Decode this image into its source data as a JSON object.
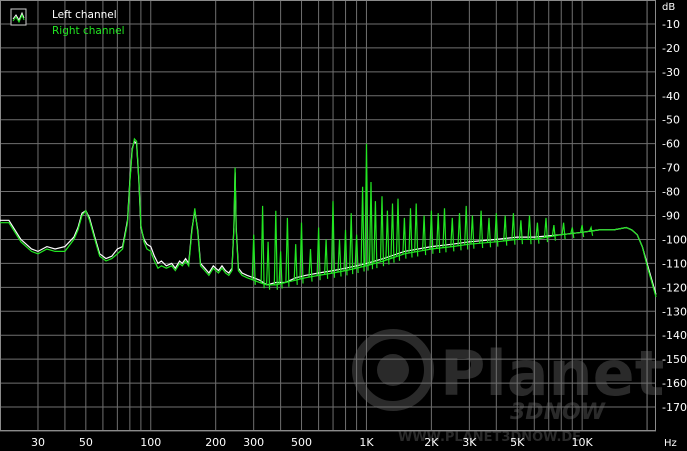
{
  "chart_data": {
    "type": "line",
    "xscale": "log",
    "xlim": [
      20,
      22000
    ],
    "ylim": [
      -180,
      0
    ],
    "x_ticks": [
      30,
      50,
      100,
      200,
      300,
      500,
      1000,
      2000,
      3000,
      5000,
      10000
    ],
    "x_tick_labels": [
      "30",
      "50",
      "100",
      "200",
      "300",
      "500",
      "1K",
      "2K",
      "3K",
      "5K",
      "10K"
    ],
    "x_unit": "Hz",
    "y_ticks": [
      -10,
      -20,
      -30,
      -40,
      -50,
      -60,
      -70,
      -80,
      -90,
      -100,
      -110,
      -120,
      -130,
      -140,
      -150,
      -160,
      -170
    ],
    "y_unit": "dB",
    "grid": true,
    "legend_position": "top-left",
    "series": [
      {
        "name": "Left channel",
        "color": "#ffffff",
        "points": [
          [
            20,
            -92
          ],
          [
            22,
            -92
          ],
          [
            25,
            -100
          ],
          [
            28,
            -104
          ],
          [
            30,
            -105
          ],
          [
            33,
            -103
          ],
          [
            36,
            -104
          ],
          [
            40,
            -103
          ],
          [
            44,
            -99
          ],
          [
            46,
            -95
          ],
          [
            48,
            -89
          ],
          [
            50,
            -88
          ],
          [
            52,
            -91
          ],
          [
            55,
            -99
          ],
          [
            58,
            -106
          ],
          [
            62,
            -108
          ],
          [
            66,
            -107
          ],
          [
            70,
            -104
          ],
          [
            74,
            -103
          ],
          [
            78,
            -92
          ],
          [
            80,
            -75
          ],
          [
            82,
            -62
          ],
          [
            84,
            -59
          ],
          [
            86,
            -60
          ],
          [
            88,
            -75
          ],
          [
            90,
            -95
          ],
          [
            93,
            -100
          ],
          [
            96,
            -102
          ],
          [
            100,
            -103
          ],
          [
            104,
            -107
          ],
          [
            108,
            -110
          ],
          [
            112,
            -109
          ],
          [
            118,
            -111
          ],
          [
            125,
            -110
          ],
          [
            130,
            -112
          ],
          [
            136,
            -109
          ],
          [
            140,
            -110
          ],
          [
            145,
            -108
          ],
          [
            150,
            -110
          ],
          [
            155,
            -96
          ],
          [
            160,
            -88
          ],
          [
            165,
            -96
          ],
          [
            170,
            -110
          ],
          [
            178,
            -112
          ],
          [
            186,
            -114
          ],
          [
            195,
            -111
          ],
          [
            200,
            -112
          ],
          [
            206,
            -113
          ],
          [
            214,
            -111
          ],
          [
            222,
            -113
          ],
          [
            230,
            -114
          ],
          [
            238,
            -112
          ],
          [
            243,
            -95
          ],
          [
            246,
            -72
          ],
          [
            249,
            -95
          ],
          [
            255,
            -112
          ],
          [
            265,
            -114
          ],
          [
            280,
            -115
          ],
          [
            300,
            -116
          ],
          [
            320,
            -117
          ],
          [
            345,
            -119
          ],
          [
            380,
            -118
          ],
          [
            420,
            -118
          ],
          [
            470,
            -116
          ],
          [
            520,
            -115
          ],
          [
            600,
            -114
          ],
          [
            700,
            -113
          ],
          [
            800,
            -112
          ],
          [
            900,
            -111
          ],
          [
            1000,
            -110
          ],
          [
            1200,
            -108
          ],
          [
            1500,
            -105
          ],
          [
            2000,
            -103
          ],
          [
            2500,
            -102
          ],
          [
            3000,
            -101
          ],
          [
            4000,
            -100
          ],
          [
            5000,
            -99
          ],
          [
            6000,
            -99
          ],
          [
            8000,
            -98
          ],
          [
            10000,
            -97
          ],
          [
            12000,
            -96
          ],
          [
            14000,
            -96
          ],
          [
            16000,
            -95
          ],
          [
            17000,
            -96
          ],
          [
            18000,
            -98
          ],
          [
            19000,
            -103
          ],
          [
            20000,
            -110
          ],
          [
            22000,
            -123
          ]
        ]
      },
      {
        "name": "Right channel",
        "color": "#22e622",
        "points": [
          [
            20,
            -93
          ],
          [
            22,
            -93
          ],
          [
            25,
            -101
          ],
          [
            28,
            -105
          ],
          [
            30,
            -106
          ],
          [
            33,
            -104
          ],
          [
            36,
            -105
          ],
          [
            40,
            -105
          ],
          [
            44,
            -100
          ],
          [
            46,
            -96
          ],
          [
            48,
            -90
          ],
          [
            50,
            -88
          ],
          [
            52,
            -92
          ],
          [
            55,
            -100
          ],
          [
            58,
            -107
          ],
          [
            62,
            -109
          ],
          [
            66,
            -108
          ],
          [
            70,
            -106
          ],
          [
            74,
            -104
          ],
          [
            78,
            -93
          ],
          [
            80,
            -76
          ],
          [
            82,
            -63
          ],
          [
            84,
            -58
          ],
          [
            86,
            -59
          ],
          [
            88,
            -74
          ],
          [
            90,
            -94
          ],
          [
            93,
            -101
          ],
          [
            96,
            -104
          ],
          [
            100,
            -105
          ],
          [
            104,
            -109
          ],
          [
            108,
            -112
          ],
          [
            112,
            -111
          ],
          [
            118,
            -112
          ],
          [
            125,
            -111
          ],
          [
            130,
            -113
          ],
          [
            136,
            -110
          ],
          [
            140,
            -111
          ],
          [
            145,
            -109
          ],
          [
            150,
            -111
          ],
          [
            155,
            -97
          ],
          [
            160,
            -87
          ],
          [
            165,
            -97
          ],
          [
            170,
            -111
          ],
          [
            178,
            -113
          ],
          [
            186,
            -115
          ],
          [
            195,
            -112
          ],
          [
            200,
            -113
          ],
          [
            206,
            -114
          ],
          [
            214,
            -112
          ],
          [
            222,
            -114
          ],
          [
            230,
            -115
          ],
          [
            238,
            -113
          ],
          [
            243,
            -95
          ],
          [
            246,
            -70
          ],
          [
            249,
            -96
          ],
          [
            255,
            -113
          ],
          [
            265,
            -115
          ],
          [
            280,
            -116
          ],
          [
            300,
            -117
          ],
          [
            320,
            -118
          ],
          [
            345,
            -119
          ],
          [
            380,
            -119
          ],
          [
            420,
            -118
          ],
          [
            470,
            -117
          ],
          [
            520,
            -116
          ],
          [
            600,
            -115
          ],
          [
            700,
            -114
          ],
          [
            800,
            -113
          ],
          [
            900,
            -112
          ],
          [
            1000,
            -111
          ],
          [
            1200,
            -109
          ],
          [
            1500,
            -106
          ],
          [
            2000,
            -104
          ],
          [
            2500,
            -103
          ],
          [
            3000,
            -102
          ],
          [
            4000,
            -101
          ],
          [
            5000,
            -100
          ],
          [
            6000,
            -100
          ],
          [
            8000,
            -98
          ],
          [
            10000,
            -97
          ],
          [
            12000,
            -96
          ],
          [
            14000,
            -96
          ],
          [
            16000,
            -95
          ],
          [
            17000,
            -96
          ],
          [
            18000,
            -98
          ],
          [
            19000,
            -103
          ],
          [
            20000,
            -111
          ],
          [
            22000,
            -124
          ]
        ],
        "spikes": [
          [
            300,
            -98
          ],
          [
            330,
            -86
          ],
          [
            350,
            -101
          ],
          [
            380,
            -88
          ],
          [
            400,
            -105
          ],
          [
            430,
            -91
          ],
          [
            470,
            -102
          ],
          [
            500,
            -93
          ],
          [
            550,
            -104
          ],
          [
            600,
            -95
          ],
          [
            650,
            -100
          ],
          [
            700,
            -84
          ],
          [
            750,
            -100
          ],
          [
            800,
            -96
          ],
          [
            850,
            -89
          ],
          [
            900,
            -98
          ],
          [
            960,
            -78
          ],
          [
            1000,
            -60
          ],
          [
            1050,
            -76
          ],
          [
            1100,
            -84
          ],
          [
            1180,
            -82
          ],
          [
            1250,
            -88
          ],
          [
            1320,
            -85
          ],
          [
            1400,
            -83
          ],
          [
            1500,
            -91
          ],
          [
            1600,
            -87
          ],
          [
            1700,
            -85
          ],
          [
            1850,
            -90
          ],
          [
            2000,
            -88
          ],
          [
            2150,
            -89
          ],
          [
            2300,
            -87
          ],
          [
            2500,
            -91
          ],
          [
            2700,
            -89
          ],
          [
            2900,
            -86
          ],
          [
            3100,
            -90
          ],
          [
            3400,
            -88
          ],
          [
            3700,
            -91
          ],
          [
            4000,
            -89
          ],
          [
            4400,
            -90
          ],
          [
            4800,
            -89
          ],
          [
            5200,
            -92
          ],
          [
            5700,
            -90
          ],
          [
            6200,
            -93
          ],
          [
            6800,
            -91
          ],
          [
            7400,
            -94
          ],
          [
            8200,
            -93
          ],
          [
            9000,
            -95
          ],
          [
            10000,
            -94
          ],
          [
            11000,
            -95
          ]
        ]
      }
    ],
    "legend": [
      {
        "label": "Left channel",
        "color": "#ffffff"
      },
      {
        "label": "Right channel",
        "color": "#22e622"
      }
    ],
    "watermark": {
      "main": "Planet",
      "sub": "3DNOW",
      "url": "WWW.PLANET3DNOW.DE"
    }
  }
}
